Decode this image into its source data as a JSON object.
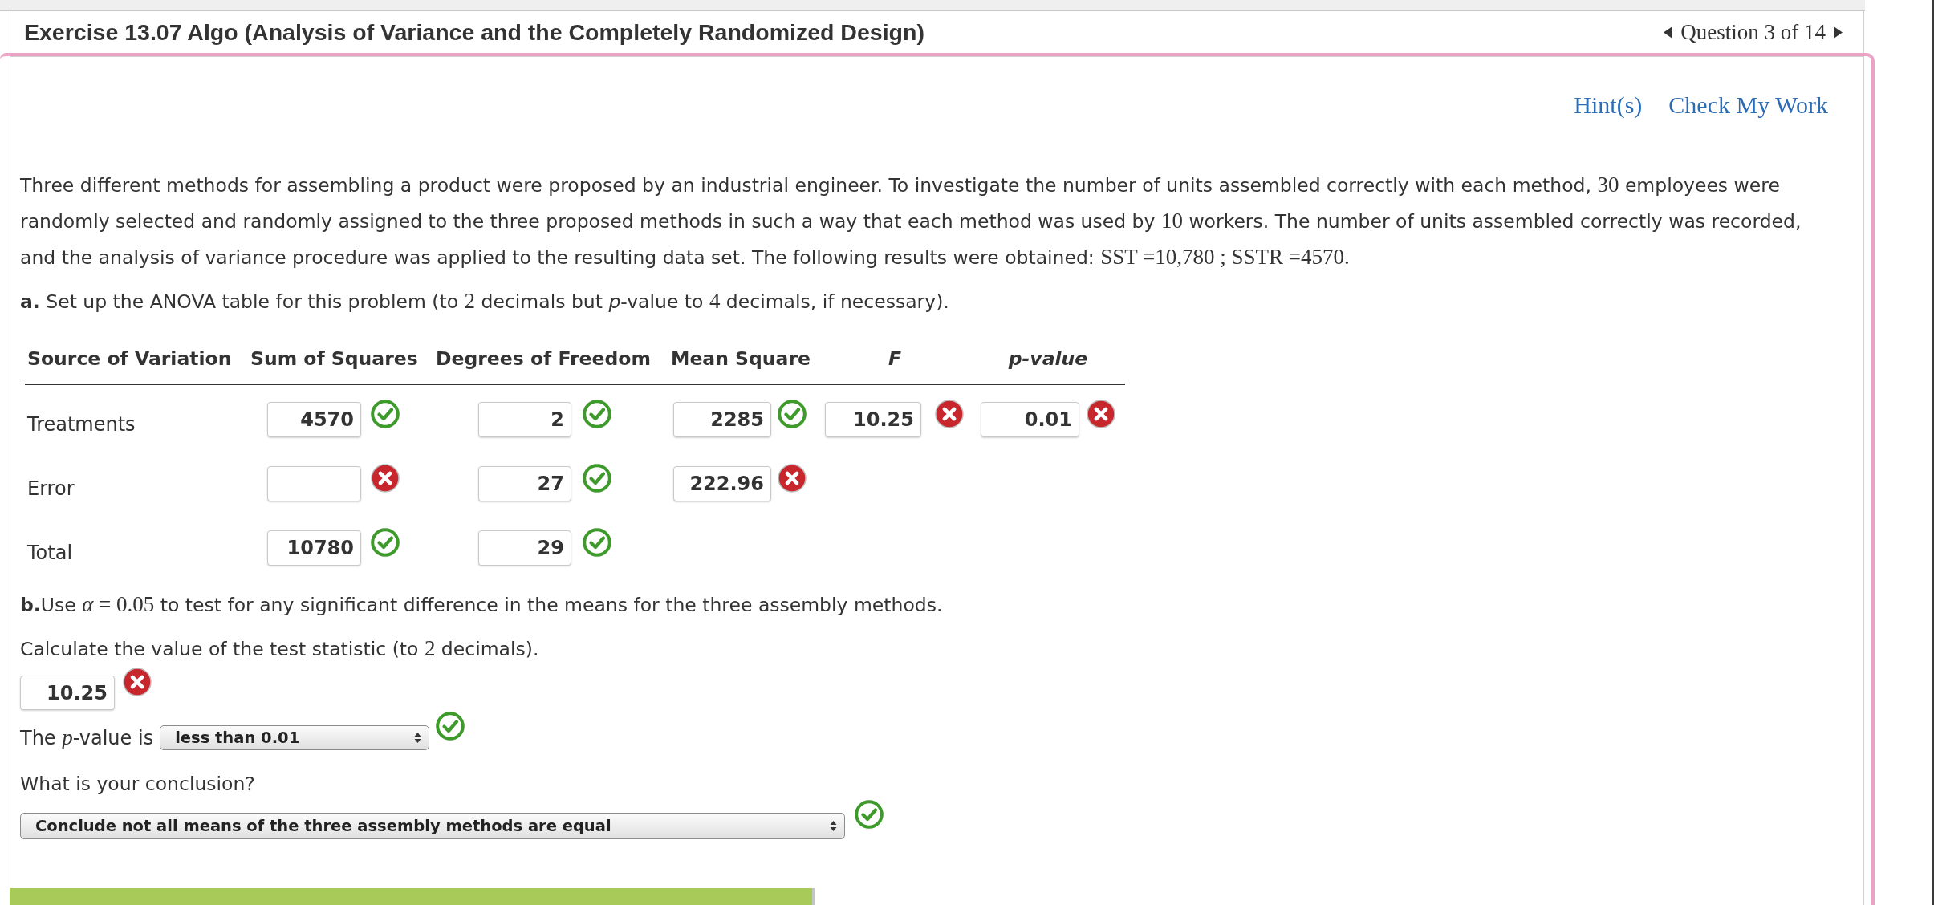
{
  "header": {
    "title": "Exercise 13.07 Algo (Analysis of Variance and the Completely Randomized Design)",
    "question_nav": "Question 3 of 14"
  },
  "links": [
    "Hint(s)",
    "Check My Work"
  ],
  "problem": [
    {
      "kind": "text",
      "text": "Three different methods for assembling a product were proposed by an industrial engineer. To investigate the number of units assembled correctly with each method, "
    },
    {
      "kind": "math",
      "text": "30"
    },
    {
      "kind": "text",
      "text": " employees were randomly selected and randomly assigned to the three proposed methods in such a way that each method was used by "
    },
    {
      "kind": "math",
      "text": "10"
    },
    {
      "kind": "text",
      "text": " workers. The number of units assembled correctly was recorded, and the analysis of variance procedure was applied to the resulting data set. The following results were obtained: "
    },
    {
      "kind": "math",
      "text": "SST =10,780 ; SSTR =4570."
    }
  ],
  "part_a": {
    "prompt": [
      {
        "kind": "bold",
        "text": "a."
      },
      {
        "kind": "text",
        "text": " Set up the ANOVA table for this problem (to "
      },
      {
        "kind": "math",
        "text": "2"
      },
      {
        "kind": "text",
        "text": " decimals but "
      },
      {
        "kind": "italic",
        "text": "p"
      },
      {
        "kind": "text",
        "text": "-value to "
      },
      {
        "kind": "math",
        "text": "4"
      },
      {
        "kind": "text",
        "text": " decimals, if necessary)."
      }
    ],
    "table": {
      "columns": [
        {
          "label": "Source of Variation",
          "kind": "source"
        },
        {
          "label": "Sum of Squares",
          "kind": "quantity"
        },
        {
          "label": "Degrees of Freedom",
          "kind": "quantity"
        },
        {
          "label": "Mean Square",
          "kind": "quantity"
        },
        {
          "label": "F",
          "kind": "statistic"
        },
        {
          "label": "p-value",
          "kind": "statistic"
        }
      ],
      "rows": [
        {
          "cells": [
            {
              "kind": "label",
              "text": "Treatments"
            },
            {
              "kind": "input",
              "value": "4570",
              "correct": true
            },
            {
              "kind": "input",
              "value": "2",
              "correct": true
            },
            {
              "kind": "input",
              "value": "2285",
              "correct": true
            },
            {
              "kind": "input",
              "value": "10.25",
              "correct": false
            },
            {
              "kind": "input",
              "value": "0.01",
              "correct": false
            }
          ]
        },
        {
          "cells": [
            {
              "kind": "label",
              "text": "Error"
            },
            {
              "kind": "input",
              "correct": false
            },
            {
              "kind": "input",
              "value": "27",
              "correct": true
            },
            {
              "kind": "input",
              "value": "222.96",
              "correct": false
            }
          ]
        },
        {
          "cells": [
            {
              "kind": "label",
              "text": "Total"
            },
            {
              "kind": "input",
              "value": "10780",
              "correct": true
            },
            {
              "kind": "input",
              "value": "29",
              "correct": true
            }
          ]
        }
      ]
    }
  },
  "part_b": {
    "prompt": [
      {
        "kind": "bold",
        "text": "b."
      },
      {
        "kind": "text",
        "text": "Use "
      },
      {
        "kind": "variable",
        "text": "α"
      },
      {
        "kind": "math",
        "text": " = 0.05"
      },
      {
        "kind": "text",
        "text": " to test for any significant difference in the means for the three assembly methods."
      }
    ],
    "statistic_prompt": [
      {
        "kind": "text",
        "text": "Calculate the value of the test statistic (to "
      },
      {
        "kind": "math",
        "text": "2"
      },
      {
        "kind": "text",
        "text": " decimals)."
      }
    ],
    "statistic_answer": {
      "value": "10.25",
      "correct": false
    },
    "p_value_prompt": [
      {
        "kind": "text",
        "text": "The "
      },
      {
        "kind": "variable",
        "text": "p"
      },
      {
        "kind": "text",
        "text": "-value is"
      }
    ],
    "p_value_select": {
      "value": "less than 0.01",
      "correct": true
    },
    "conclusion_prompt": "What is your conclusion?",
    "conclusion_select": {
      "value": "Conclude not all means of the three assembly methods are equal",
      "correct": true
    }
  }
}
